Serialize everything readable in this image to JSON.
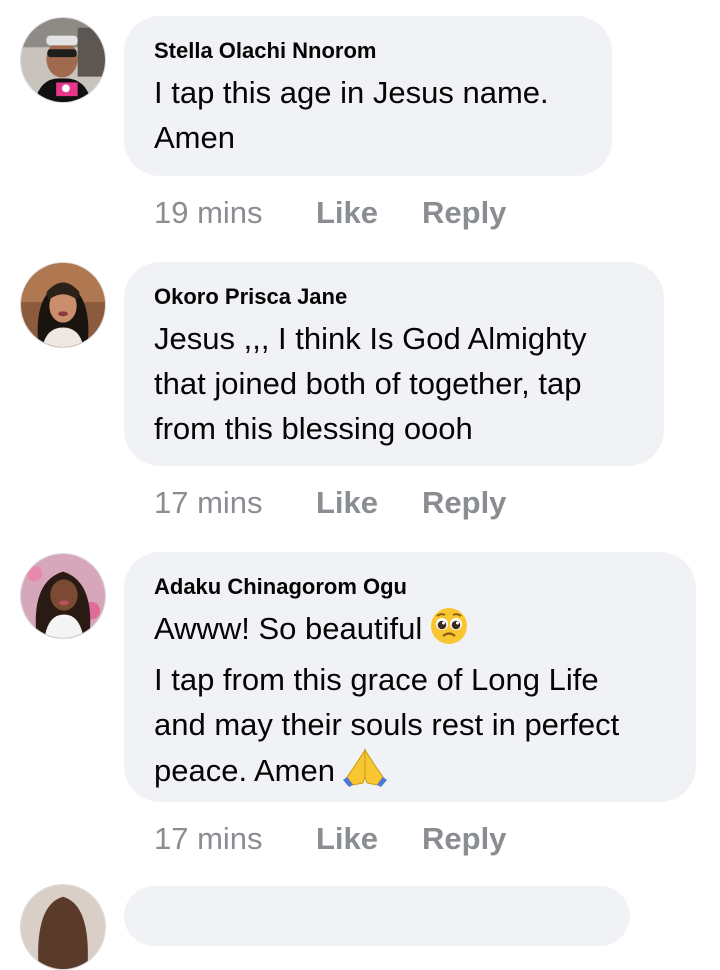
{
  "comments": [
    {
      "author": "Stella Olachi Nnorom",
      "lines": [
        "I tap this age in Jesus name.",
        "Amen"
      ],
      "time": "19 mins",
      "like_label": "Like",
      "reply_label": "Reply"
    },
    {
      "author": "Okoro Prisca Jane",
      "lines": [
        "Jesus ,,,   I think Is God Almighty",
        "that joined both of together,  tap",
        "from this blessing oooh"
      ],
      "time": "17 mins",
      "like_label": "Like",
      "reply_label": "Reply"
    },
    {
      "author": "Adaku Chinagorom Ogu",
      "lines": [
        "Awww! So beautiful",
        "I tap from this grace of Long Life",
        "and may their souls rest in perfect",
        "peace. Amen"
      ],
      "time": "17 mins",
      "like_label": "Like",
      "reply_label": "Reply",
      "emojis": [
        "pleading-face-emoji",
        "folded-hands-emoji"
      ]
    }
  ],
  "colors": {
    "bubble": "#f0f2f5",
    "meta_text": "#8a8d91",
    "author_text": "#050505"
  }
}
